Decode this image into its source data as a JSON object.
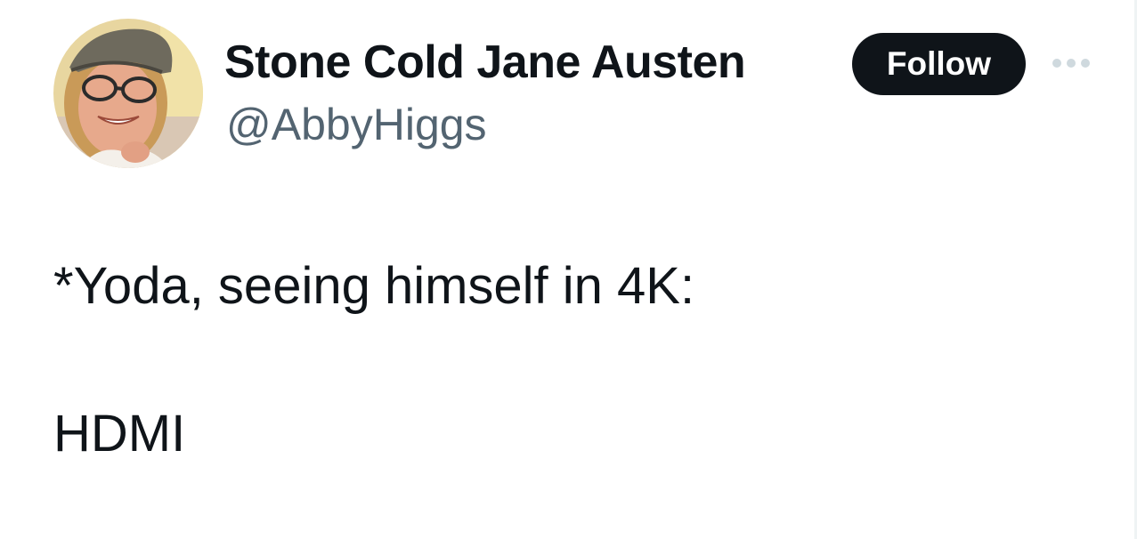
{
  "author": {
    "display_name": "Stone Cold Jane Austen",
    "handle": "@AbbyHiggs",
    "avatar_icon": "profile-photo"
  },
  "actions": {
    "follow_label": "Follow",
    "more_icon": "more-horizontal-icon"
  },
  "tweet": {
    "line1": "*Yoda, seeing himself in 4K:",
    "line2": "HDMI"
  },
  "colors": {
    "text": "#0f1419",
    "secondary_text": "#536471",
    "follow_bg": "#0f1419",
    "follow_text": "#ffffff",
    "more_icon": "#cfd9de"
  }
}
